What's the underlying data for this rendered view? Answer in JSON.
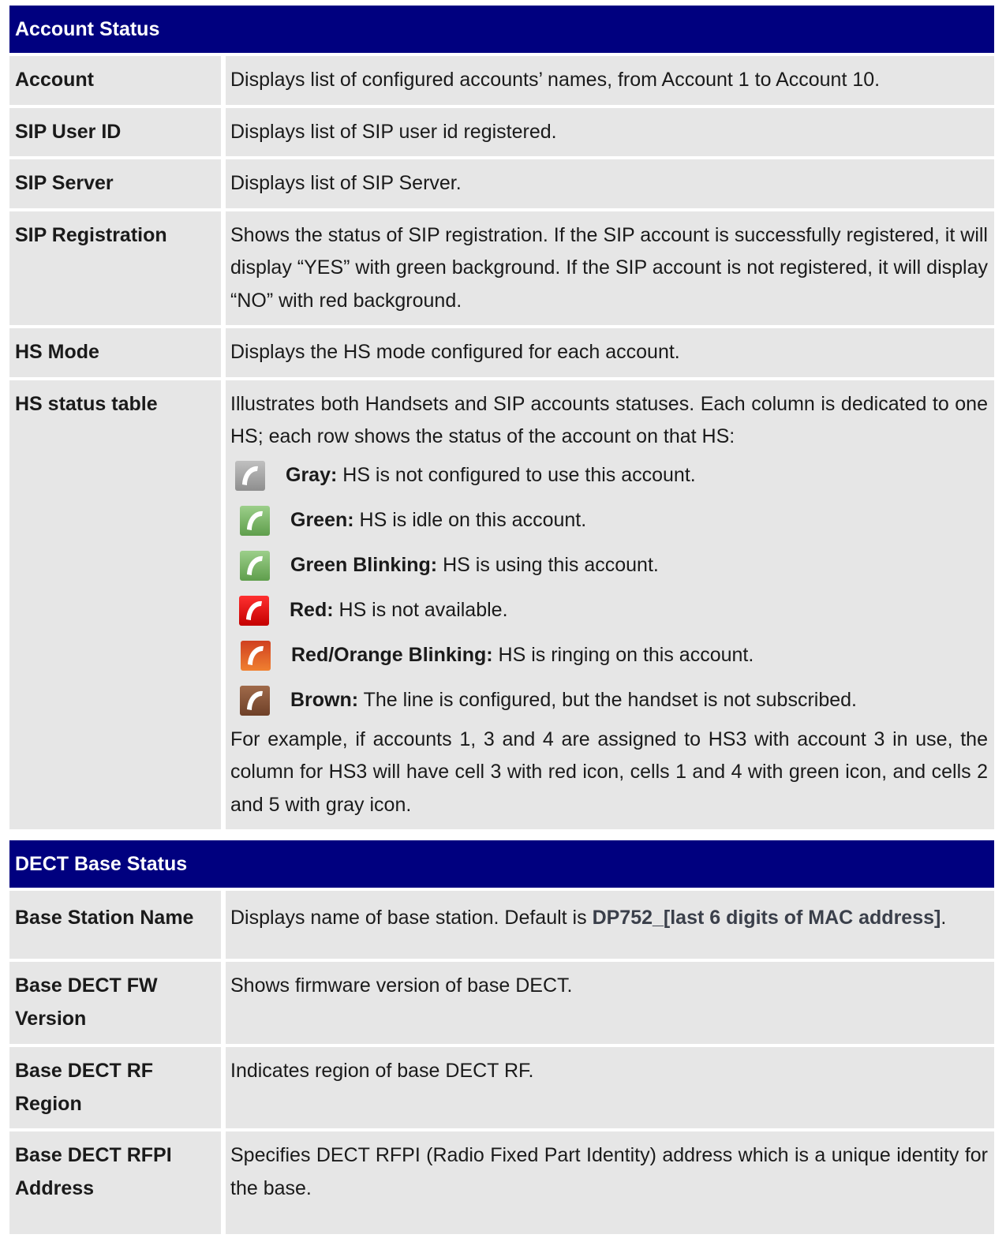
{
  "account_status": {
    "header": "Account Status",
    "rows": [
      {
        "name": "Account",
        "desc": "Displays list of configured accounts’ names, from Account 1 to Account 10."
      },
      {
        "name": "SIP User ID",
        "desc": "Displays list of SIP user id registered."
      },
      {
        "name": "SIP Server",
        "desc": "Displays list of SIP Server."
      },
      {
        "name": "SIP Registration",
        "desc": "Shows the status of SIP registration. If the SIP account is successfully registered, it will display “YES” with green background. If the SIP account is not registered, it will display “NO” with red background."
      },
      {
        "name": "HS Mode",
        "desc": "Displays the HS mode configured for each account."
      }
    ],
    "hs_status": {
      "name": "HS status table",
      "intro": "Illustrates both Handsets and SIP accounts statuses. Each column is dedicated to one HS; each row shows the status of the account on that HS:",
      "legend": [
        {
          "icon": "phone-gray-icon",
          "color": "#9e9e9e",
          "label": "Gray:",
          "text": " HS is not configured to use this account."
        },
        {
          "icon": "phone-green-icon",
          "color": "#7ab866",
          "label": "Green:",
          "text": " HS is idle on this account."
        },
        {
          "icon": "phone-green-blinking-icon",
          "color": "#7ab866",
          "label": "Green Blinking:",
          "text": " HS is using this account."
        },
        {
          "icon": "phone-red-icon",
          "color": "#e01010",
          "label": "Red:",
          "text": " HS is not available."
        },
        {
          "icon": "phone-red-orange-blinking-icon",
          "color": "#e06028",
          "label": "Red/Orange Blinking:",
          "text": " HS is ringing on this account."
        },
        {
          "icon": "phone-brown-icon",
          "color": "#8a5538",
          "label": "Brown:",
          "text": " The line is configured, but the handset is not subscribed."
        }
      ],
      "example": "For example, if accounts 1, 3 and 4 are assigned to HS3 with account 3 in use, the column for HS3 will have cell 3 with red icon, cells 1 and 4 with green icon, and cells 2 and 5 with gray icon."
    }
  },
  "dect_base_status": {
    "header": "DECT Base Status",
    "base_station": {
      "name": "Base Station Name",
      "desc_prefix": "Displays name of base station. Default is ",
      "desc_default": "DP752_[last 6 digits of MAC address]",
      "desc_suffix": "."
    },
    "rows": [
      {
        "name": "Base DECT FW Version",
        "desc": "Shows firmware version of base DECT."
      },
      {
        "name": "Base DECT RF Region",
        "desc": "Indicates region of base DECT RF."
      },
      {
        "name": "Base DECT RFPI Address",
        "desc": "Specifies DECT RFPI (Radio Fixed Part Identity) address which is a unique identity for the base."
      }
    ]
  },
  "colors": {
    "header_bg": "#00007f",
    "cell_bg": "#e6e6e6"
  }
}
